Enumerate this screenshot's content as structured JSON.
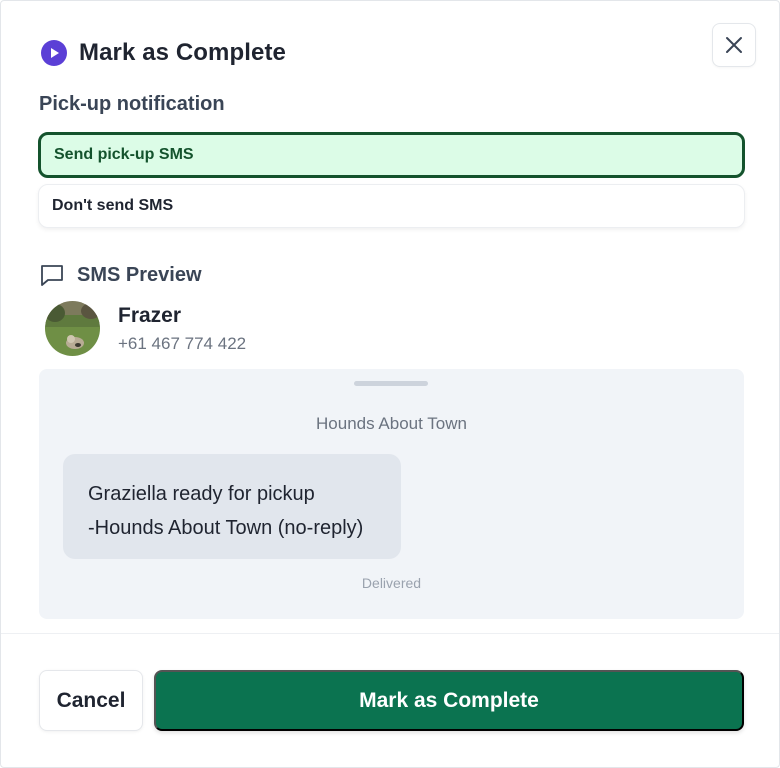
{
  "dialog": {
    "title": "Mark as Complete",
    "close_icon": "close-icon",
    "title_icon": "play-circle-icon"
  },
  "notification": {
    "heading": "Pick-up notification",
    "options": [
      {
        "label": "Send pick-up SMS",
        "selected": true
      },
      {
        "label": "Don't send SMS",
        "selected": false
      }
    ]
  },
  "preview": {
    "heading": "SMS Preview",
    "icon": "chat-bubble-icon",
    "contact": {
      "name": "Frazer",
      "phone": "+61 467 774 422"
    },
    "sender": "Hounds About Town",
    "message_lines": [
      "Graziella ready for pickup",
      "-Hounds About Town (no-reply)"
    ],
    "status": "Delivered"
  },
  "footer": {
    "cancel_label": "Cancel",
    "confirm_label": "Mark as Complete"
  },
  "colors": {
    "accent": "#5b3fd6",
    "primary_button": "#0b7350",
    "selected_bg": "#dcfce7",
    "selected_border": "#14532d"
  }
}
